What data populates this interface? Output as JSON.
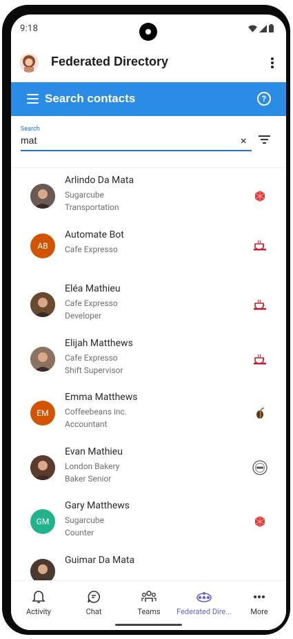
{
  "status": {
    "time": "9:18"
  },
  "app": {
    "title": "Federated Directory"
  },
  "searchbar": {
    "title": "Search contacts",
    "help": "?"
  },
  "search": {
    "label": "Search",
    "value": "mat",
    "clear": "×"
  },
  "contacts": [
    {
      "name": "Arlindo Da Mata",
      "line1": "Sugarcube",
      "line2": "Transportation",
      "initials": "",
      "avatar_color": "#6b5a53",
      "org": "sugarcube"
    },
    {
      "name": "Automate Bot",
      "line1": "Cafe Expresso",
      "line2": "",
      "initials": "AB",
      "avatar_color": "#d35400",
      "org": "cafe"
    },
    {
      "name": "Eléa Mathieu",
      "line1": "Cafe Expresso",
      "line2": "Developer",
      "initials": "",
      "avatar_color": "#6a4a2f",
      "org": "cafe"
    },
    {
      "name": "Elijah Matthews",
      "line1": "Cafe Expresso",
      "line2": "Shift Supervisor",
      "initials": "",
      "avatar_color": "#8b7160",
      "org": "cafe"
    },
    {
      "name": "Emma Matthews",
      "line1": "Coffeebeans inc.",
      "line2": "Accountant",
      "initials": "EM",
      "avatar_color": "#d35400",
      "org": "coffeebeans"
    },
    {
      "name": "Evan Mathieu",
      "line1": "London Bakery",
      "line2": "Baker Senior",
      "initials": "",
      "avatar_color": "#5a3b2c",
      "org": "bakery"
    },
    {
      "name": "Gary Matthews",
      "line1": "Sugarcube",
      "line2": "Counter",
      "initials": "GM",
      "avatar_color": "#22b38d",
      "org": "sugarcube"
    },
    {
      "name": "Guimar Da Mata",
      "line1": "",
      "line2": "",
      "initials": "",
      "avatar_color": "#4b3a30",
      "org": ""
    }
  ],
  "nav": {
    "activity": "Activity",
    "chat": "Chat",
    "teams": "Teams",
    "federated": "Federated Dire...",
    "more": "More"
  },
  "colors": {
    "accent_blue": "#2b8ce6",
    "nav_active": "#6264c9",
    "initials_orange": "#d35400",
    "initials_green": "#22b38d"
  }
}
